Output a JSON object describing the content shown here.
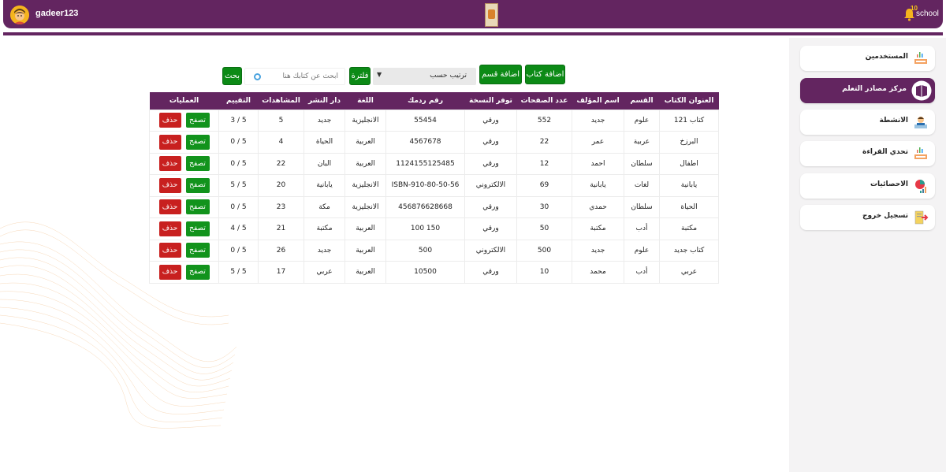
{
  "header": {
    "username": "gadeer123",
    "notification_count": "10",
    "school_label": "school"
  },
  "sidebar": {
    "items": [
      {
        "label": "المستخدمين",
        "icon": "books-icon"
      },
      {
        "label": "مركز مصادر التعلم",
        "icon": "book-icon",
        "active": true
      },
      {
        "label": "الانشطة",
        "icon": "activities-icon"
      },
      {
        "label": "تحدي القراءة",
        "icon": "reading-challenge-icon"
      },
      {
        "label": "الاحصائيات",
        "icon": "stats-icon"
      },
      {
        "label": "تسجيل خروج",
        "icon": "logout-icon"
      }
    ]
  },
  "toolbar": {
    "add_book": "اضافة كتاب",
    "add_section": "اضافة قسم",
    "sort_label": "ترتيب حسب",
    "filter_label": "فلترة",
    "search_placeholder": "أبحث عن كتابك هنا",
    "search_button": "بحث"
  },
  "table": {
    "headers": [
      "العنوان الكتاب",
      "القسم",
      "اسم المؤلف",
      "عدد الصفحات",
      "توفر النسخة",
      "رقم ردمك",
      "اللغة",
      "دار النشر",
      "المشاهدات",
      "التقييم",
      "العمليات"
    ],
    "browse_label": "تصفح",
    "delete_label": "حذف",
    "rows": [
      {
        "title": "كتاب 121",
        "section": "علوم",
        "author": "جديد",
        "pages": "552",
        "availability": "ورقي",
        "isbn": "55454",
        "language": "الانجليزية",
        "publisher": "جديد",
        "views": "5",
        "rating": "3 / 5"
      },
      {
        "title": "البرزخ",
        "section": "عربية",
        "author": "عمر",
        "pages": "22",
        "availability": "ورقي",
        "isbn": "4567678",
        "language": "العربية",
        "publisher": "الحياة",
        "views": "4",
        "rating": "0 / 5"
      },
      {
        "title": "اطفال",
        "section": "سلطان",
        "author": "احمد",
        "pages": "12",
        "availability": "ورقي",
        "isbn": "1124155125485",
        "language": "العربية",
        "publisher": "البان",
        "views": "22",
        "rating": "0 / 5"
      },
      {
        "title": "يابانية",
        "section": "لغات",
        "author": "يابانية",
        "pages": "69",
        "availability": "الالكتروني",
        "isbn": "ISBN-910-80-50-56",
        "language": "الانجليزية",
        "publisher": "يابانية",
        "views": "20",
        "rating": "5 / 5"
      },
      {
        "title": "الحياة",
        "section": "سلطان",
        "author": "حمدي",
        "pages": "30",
        "availability": "ورقي",
        "isbn": "456876628668",
        "language": "الانجليزية",
        "publisher": "مكة",
        "views": "23",
        "rating": "0 / 5"
      },
      {
        "title": "مكتبة",
        "section": "أدب",
        "author": "مكتبة",
        "pages": "50",
        "availability": "ورقي",
        "isbn": "100 150",
        "language": "العربية",
        "publisher": "مكتبة",
        "views": "21",
        "rating": "4 / 5"
      },
      {
        "title": "كتاب جديد",
        "section": "علوم",
        "author": "جديد",
        "pages": "500",
        "availability": "الالكتروني",
        "isbn": "500",
        "language": "العربية",
        "publisher": "جديد",
        "views": "26",
        "rating": "0 / 5"
      },
      {
        "title": "عربي",
        "section": "أدب",
        "author": "محمد",
        "pages": "10",
        "availability": "ورقي",
        "isbn": "10500",
        "language": "العربية",
        "publisher": "عربي",
        "views": "17",
        "rating": "5 / 5"
      }
    ]
  },
  "colors": {
    "brand": "#632560",
    "success": "#12931c",
    "danger": "#c8201f"
  }
}
